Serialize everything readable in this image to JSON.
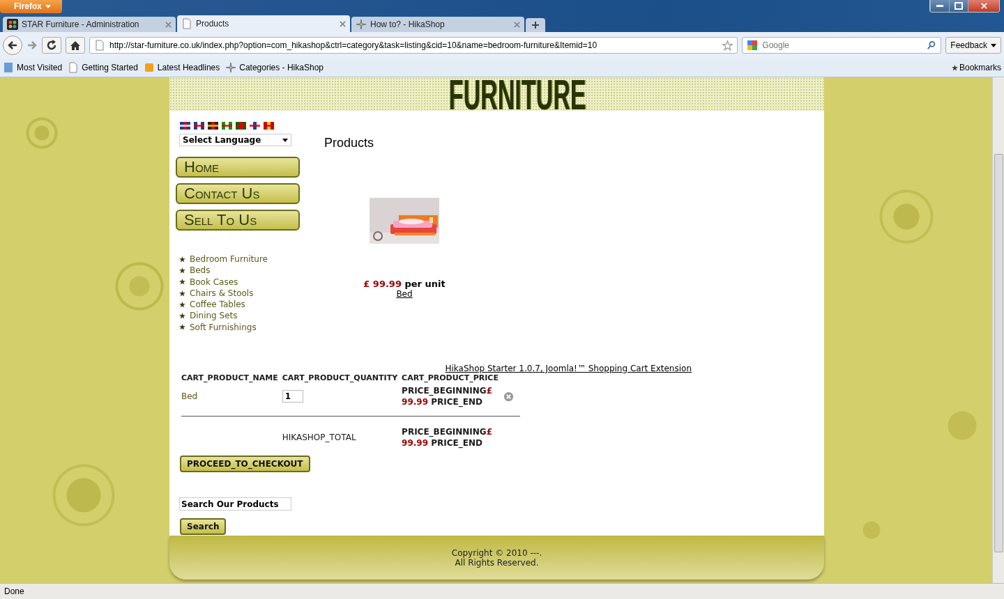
{
  "browser": {
    "app_button": "Firefox",
    "tabs": [
      {
        "title": "STAR Furniture - Administration",
        "selected": false
      },
      {
        "title": "Products",
        "selected": true
      },
      {
        "title": "How to? - HikaShop",
        "selected": false
      }
    ],
    "url": "http://star-furniture.co.uk/index.php?option=com_hikashop&ctrl=category&task=listing&cid=10&name=bedroom-furniture&Itemid=10",
    "search_placeholder": "Google",
    "feedback": "Feedback",
    "bookmarks": [
      "Most Visited",
      "Getting Started",
      "Latest Headlines",
      "Categories - HikaShop"
    ],
    "bookmarks_menu": "Bookmarks",
    "status": "Done"
  },
  "site": {
    "banner": "FURNITURE",
    "language_select": "Select Language",
    "nav": [
      "Home",
      "Contact Us",
      "Sell To Us"
    ],
    "categories": [
      "Bedroom Furniture",
      "Beds",
      "Book Cases",
      "Chairs & Stools",
      "Coffee Tables",
      "Dining Sets",
      "Soft Furnishings"
    ],
    "heading": "Products",
    "product": {
      "kind": "picture",
      "price": "£ 99.99",
      "unit": "per unit",
      "name": "Bed"
    },
    "credit_link": "HikaShop Starter 1.0.7, Joomla!™ Shopping Cart Extension",
    "cart": {
      "columns": [
        "CART_PRODUCT_NAME",
        "CART_PRODUCT_QUANTITY",
        "CART_PRODUCT_PRICE"
      ],
      "rows": [
        {
          "name": "Bed",
          "quantity": "1",
          "price_begin": "PRICE_BEGINNING",
          "currency": "£",
          "amount": "99.99",
          "price_end": "PRICE_END"
        }
      ],
      "total": {
        "label": "HIKASHOP_TOTAL",
        "price_begin": "PRICE_BEGINNING",
        "currency": "£",
        "amount": "99.99",
        "price_end": "PRICE_END"
      },
      "checkout": "PROCEED_TO_CHECKOUT"
    },
    "search": {
      "value": "Search Our Products",
      "button": "Search"
    },
    "footer": [
      "Copyright © 2010 ---.",
      "All Rights Reserved."
    ]
  }
}
